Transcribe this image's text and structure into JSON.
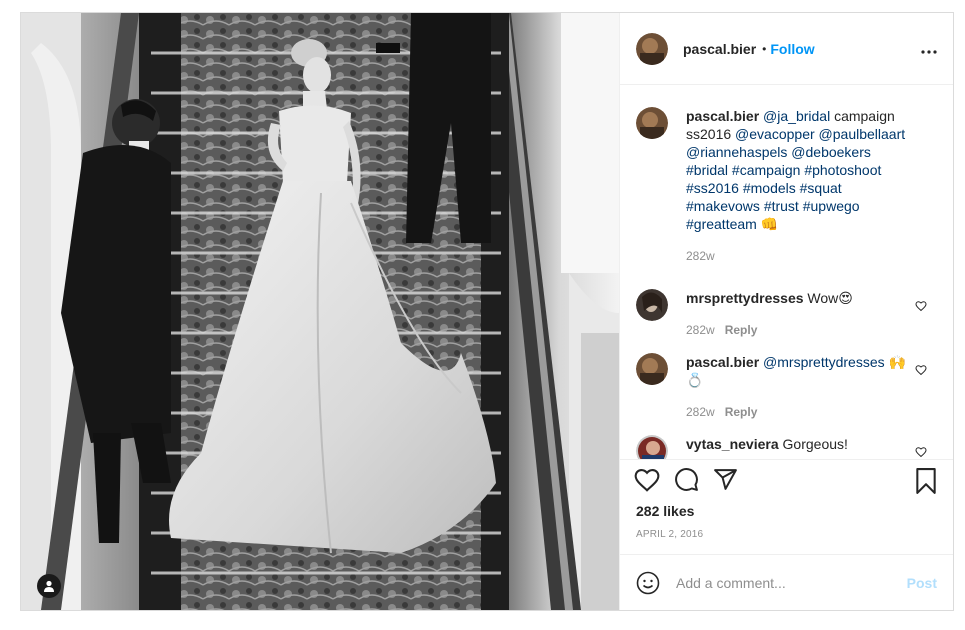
{
  "header": {
    "username": "pascal.bier",
    "separator": "•",
    "follow_label": "Follow",
    "more_icon": "more-options-icon"
  },
  "caption": {
    "username": "pascal.bier",
    "segments": [
      {
        "text": "@ja_bridal",
        "kind": "mention"
      },
      {
        "text": " campaign ss2016 ",
        "kind": "plain"
      },
      {
        "text": "@evacopper",
        "kind": "mention"
      },
      {
        "text": " ",
        "kind": "plain"
      },
      {
        "text": "@paulbellaart",
        "kind": "mention"
      },
      {
        "text": " ",
        "kind": "plain"
      },
      {
        "text": "@riannehaspels",
        "kind": "mention"
      },
      {
        "text": " ",
        "kind": "plain"
      },
      {
        "text": "@deboekers",
        "kind": "mention"
      },
      {
        "text": " ",
        "kind": "plain"
      },
      {
        "text": "#bridal",
        "kind": "mention"
      },
      {
        "text": " ",
        "kind": "plain"
      },
      {
        "text": "#campaign",
        "kind": "mention"
      },
      {
        "text": " ",
        "kind": "plain"
      },
      {
        "text": "#photoshoot",
        "kind": "mention"
      },
      {
        "text": " ",
        "kind": "plain"
      },
      {
        "text": "#ss2016",
        "kind": "mention"
      },
      {
        "text": " ",
        "kind": "plain"
      },
      {
        "text": "#models",
        "kind": "mention"
      },
      {
        "text": " ",
        "kind": "plain"
      },
      {
        "text": "#squat",
        "kind": "mention"
      },
      {
        "text": " ",
        "kind": "plain"
      },
      {
        "text": "#makevows",
        "kind": "mention"
      },
      {
        "text": " ",
        "kind": "plain"
      },
      {
        "text": "#trust",
        "kind": "mention"
      },
      {
        "text": " ",
        "kind": "plain"
      },
      {
        "text": "#upwego",
        "kind": "mention"
      },
      {
        "text": " ",
        "kind": "plain"
      },
      {
        "text": "#greatteam",
        "kind": "mention"
      },
      {
        "text": " 👊",
        "kind": "plain"
      }
    ],
    "time": "282w"
  },
  "comments": [
    {
      "username": "mrsprettydresses",
      "text": "Wow😍",
      "mention": "",
      "time": "282w",
      "reply_label": "Reply",
      "avatar_color": "#5a4a3e"
    },
    {
      "username": "pascal.bier",
      "text": " 🙌💍",
      "mention": "@mrsprettydresses",
      "time": "282w",
      "reply_label": "Reply",
      "avatar_color": "#7a5a3a"
    },
    {
      "username": "vytas_neviera",
      "text": "Gorgeous!",
      "mention": "",
      "time": "",
      "reply_label": "",
      "avatar_color": "#9a3a30"
    }
  ],
  "actions": {
    "like_icon": "heart-icon",
    "comment_icon": "comment-icon",
    "share_icon": "share-icon",
    "save_icon": "bookmark-icon"
  },
  "likes_text": "282 likes",
  "date_text": "APRIL 2, 2016",
  "add_comment": {
    "placeholder": "Add a comment...",
    "post_label": "Post",
    "emoji_icon": "emoji-icon"
  },
  "colors": {
    "link": "#0095f6",
    "mention": "#00376b",
    "muted": "#8e8e8e",
    "post_disabled": "#b2dffc"
  }
}
